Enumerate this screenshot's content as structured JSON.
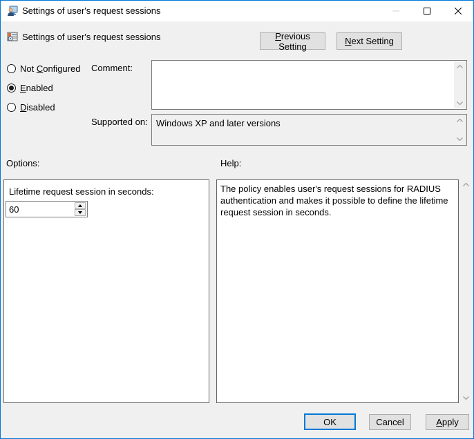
{
  "window": {
    "title": "Settings of user's request sessions"
  },
  "colors": {
    "accent": "#0078d7",
    "dialog_bg": "#f0f0f0",
    "button_bg": "#e1e1e1"
  },
  "header": {
    "title": "Settings of user's request sessions",
    "previous_button": {
      "key": "P",
      "rest": "revious Setting"
    },
    "next_button": {
      "key": "N",
      "rest": "ext Setting"
    }
  },
  "state_options": {
    "not_configured": {
      "pre": "Not ",
      "key": "C",
      "rest": "onfigured",
      "selected": false
    },
    "enabled": {
      "pre": "",
      "key": "E",
      "rest": "nabled",
      "selected": true
    },
    "disabled": {
      "pre": "",
      "key": "D",
      "rest": "isabled",
      "selected": false
    }
  },
  "comment": {
    "label": "Comment:",
    "value": ""
  },
  "supported": {
    "label": "Supported on:",
    "value": "Windows XP and later versions"
  },
  "options": {
    "section_label": "Options:",
    "field_label": "Lifetime request session in seconds:",
    "field_value": "60"
  },
  "help": {
    "section_label": "Help:",
    "text": "The policy enables user's request sessions for RADIUS authentication and makes it possible to define the lifetime request session in seconds."
  },
  "footer": {
    "ok": "OK",
    "cancel": "Cancel",
    "apply": {
      "key": "A",
      "rest": "pply"
    }
  }
}
